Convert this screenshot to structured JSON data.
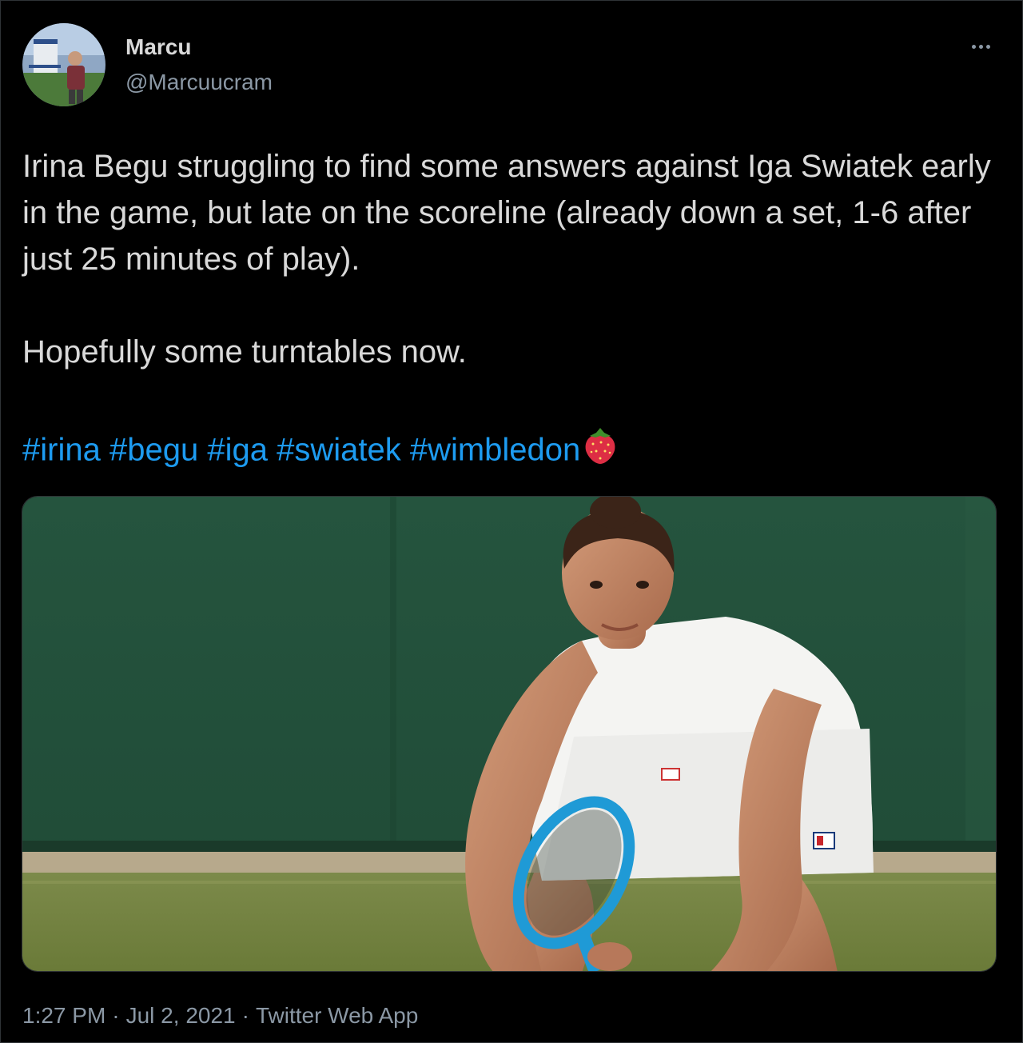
{
  "author": {
    "display_name": "Marcu",
    "handle": "@Marcuucram"
  },
  "tweet": {
    "paragraph_1": "Irina Begu struggling to find some answers against Iga Swiatek early in the game, but late on the scoreline (already down a set, 1-6 after just 25 minutes of play).",
    "paragraph_2": "Hopefully some turntables now.",
    "hashtags": [
      "#irina",
      "#begu",
      "#iga",
      "#swiatek",
      "#wimbledon"
    ],
    "emoji": "strawberry-emoji"
  },
  "meta": {
    "time": "1:27 PM",
    "separator": "·",
    "date": "Jul 2, 2021",
    "source": "Twitter Web App"
  },
  "icons": {
    "more": "more-horizontal-icon"
  },
  "colors": {
    "background": "#000000",
    "text": "#d9d9d9",
    "secondary_text": "#8b98a5",
    "link": "#1d9bf0"
  }
}
